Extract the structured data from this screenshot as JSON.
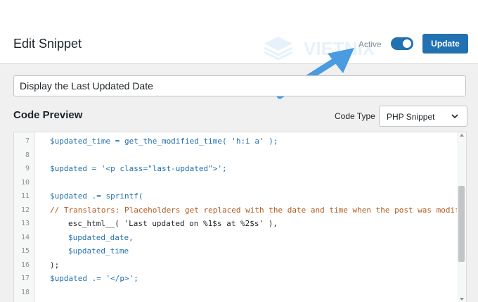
{
  "header": {
    "title": "Edit Snippet",
    "active_label": "Active",
    "update_label": "Update",
    "watermark_text": "VIETNIX"
  },
  "snippet": {
    "title_value": "Display the Last Updated Date"
  },
  "code_preview": {
    "heading": "Code Preview",
    "code_type_label": "Code Type",
    "code_type_value": "PHP Snippet"
  },
  "editor": {
    "lines": [
      {
        "num": "7",
        "text": "$updated_time = get_the_modified_time( 'h:i a' );"
      },
      {
        "num": "8",
        "text": ""
      },
      {
        "num": "9",
        "text": "$updated = '<p class=\"last-updated\">';"
      },
      {
        "num": "10",
        "text": ""
      },
      {
        "num": "11",
        "text": "$updated .= sprintf("
      },
      {
        "num": "12",
        "text": "// Translators: Placeholders get replaced with the date and time when the post was modified."
      },
      {
        "num": "13",
        "text": "esc_html__( 'Last updated on %1$s at %2$s' ),"
      },
      {
        "num": "14",
        "text": "$updated_date,"
      },
      {
        "num": "15",
        "text": "$updated_time"
      },
      {
        "num": "16",
        "text": ");"
      },
      {
        "num": "17",
        "text": "$updated .= '</p>';"
      },
      {
        "num": "18",
        "text": ""
      }
    ]
  },
  "colors": {
    "accent": "#2271b1",
    "string": "#b35a1f",
    "arrow": "#4a9be0"
  },
  "icons": {
    "select": "chevron-down-icon",
    "annotation": "arrow-icon"
  }
}
